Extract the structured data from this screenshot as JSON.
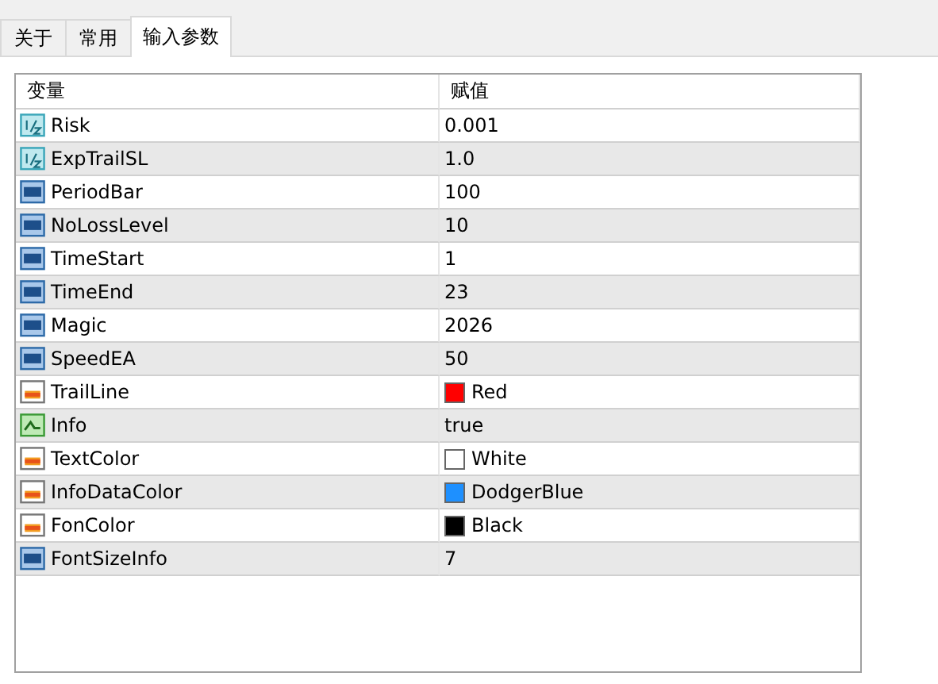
{
  "tabs": [
    {
      "label": "关于",
      "selected": false
    },
    {
      "label": "常用",
      "selected": false
    },
    {
      "label": "输入参数",
      "selected": true
    }
  ],
  "table": {
    "columns": [
      "变量",
      "赋值"
    ],
    "rows": [
      {
        "kind": "double",
        "name": "Risk",
        "value": "0.001"
      },
      {
        "kind": "double",
        "name": "ExpTrailSL",
        "value": "1.0"
      },
      {
        "kind": "int",
        "name": "PeriodBar",
        "value": "100"
      },
      {
        "kind": "int",
        "name": "NoLossLevel",
        "value": "10"
      },
      {
        "kind": "int",
        "name": "TimeStart",
        "value": "1"
      },
      {
        "kind": "int",
        "name": "TimeEnd",
        "value": "23"
      },
      {
        "kind": "int",
        "name": "Magic",
        "value": "2026"
      },
      {
        "kind": "int",
        "name": "SpeedEA",
        "value": "50"
      },
      {
        "kind": "color",
        "name": "TrailLine",
        "value": "Red",
        "color": "#ff0000"
      },
      {
        "kind": "bool",
        "name": "Info",
        "value": "true"
      },
      {
        "kind": "color",
        "name": "TextColor",
        "value": "White",
        "color": "#ffffff"
      },
      {
        "kind": "color",
        "name": "InfoDataColor",
        "value": "DodgerBlue",
        "color": "#1e90ff"
      },
      {
        "kind": "color",
        "name": "FonColor",
        "value": "Black",
        "color": "#000000"
      },
      {
        "kind": "int",
        "name": "FontSizeInfo",
        "value": "7"
      }
    ]
  }
}
